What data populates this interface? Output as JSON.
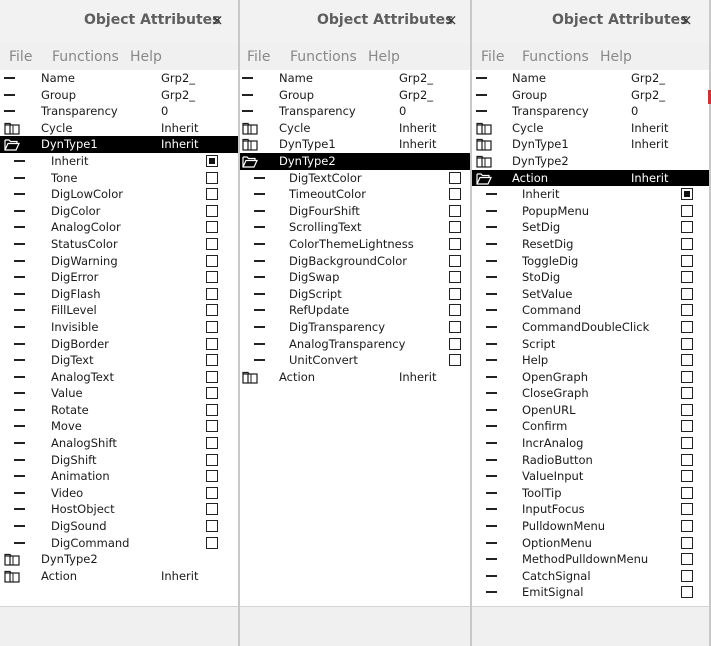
{
  "windows": [
    {
      "title": "Object Attributes",
      "close": "×",
      "menu": [
        "File",
        "Functions",
        "Help"
      ],
      "rows": [
        {
          "type": "attr",
          "name": "Name",
          "value": "Grp2_"
        },
        {
          "type": "attr",
          "name": "Group",
          "value": "Grp2_"
        },
        {
          "type": "attr",
          "name": "Transparency",
          "value": "0"
        },
        {
          "type": "folder",
          "name": "Cycle",
          "value": "Inherit"
        },
        {
          "type": "folder-open",
          "name": "DynType1",
          "value": "Inherit",
          "selected": true
        },
        {
          "type": "check",
          "name": "Inherit",
          "checked": true
        },
        {
          "type": "check",
          "name": "Tone"
        },
        {
          "type": "check",
          "name": "DigLowColor"
        },
        {
          "type": "check",
          "name": "DigColor"
        },
        {
          "type": "check",
          "name": "AnalogColor"
        },
        {
          "type": "check",
          "name": "StatusColor"
        },
        {
          "type": "check",
          "name": "DigWarning"
        },
        {
          "type": "check",
          "name": "DigError"
        },
        {
          "type": "check",
          "name": "DigFlash"
        },
        {
          "type": "check",
          "name": "FillLevel"
        },
        {
          "type": "check",
          "name": "Invisible"
        },
        {
          "type": "check",
          "name": "DigBorder"
        },
        {
          "type": "check",
          "name": "DigText"
        },
        {
          "type": "check",
          "name": "AnalogText"
        },
        {
          "type": "check",
          "name": "Value"
        },
        {
          "type": "check",
          "name": "Rotate"
        },
        {
          "type": "check",
          "name": "Move"
        },
        {
          "type": "check",
          "name": "AnalogShift"
        },
        {
          "type": "check",
          "name": "DigShift"
        },
        {
          "type": "check",
          "name": "Animation"
        },
        {
          "type": "check",
          "name": "Video"
        },
        {
          "type": "check",
          "name": "HostObject"
        },
        {
          "type": "check",
          "name": "DigSound"
        },
        {
          "type": "check",
          "name": "DigCommand"
        },
        {
          "type": "folder",
          "name": "DynType2",
          "value": ""
        },
        {
          "type": "folder",
          "name": "Action",
          "value": "Inherit"
        }
      ]
    },
    {
      "title": "Object Attributes",
      "close": "×",
      "menu": [
        "File",
        "Functions",
        "Help"
      ],
      "rows": [
        {
          "type": "attr",
          "name": "Name",
          "value": "Grp2_"
        },
        {
          "type": "attr",
          "name": "Group",
          "value": "Grp2_"
        },
        {
          "type": "attr",
          "name": "Transparency",
          "value": "0"
        },
        {
          "type": "folder",
          "name": "Cycle",
          "value": "Inherit"
        },
        {
          "type": "folder",
          "name": "DynType1",
          "value": "Inherit"
        },
        {
          "type": "folder-open",
          "name": "DynType2",
          "value": "",
          "selected": true
        },
        {
          "type": "check",
          "name": "DigTextColor"
        },
        {
          "type": "check",
          "name": "TimeoutColor"
        },
        {
          "type": "check",
          "name": "DigFourShift"
        },
        {
          "type": "check",
          "name": "ScrollingText"
        },
        {
          "type": "check",
          "name": "ColorThemeLightness"
        },
        {
          "type": "check",
          "name": "DigBackgroundColor"
        },
        {
          "type": "check",
          "name": "DigSwap"
        },
        {
          "type": "check",
          "name": "DigScript"
        },
        {
          "type": "check",
          "name": "RefUpdate"
        },
        {
          "type": "check",
          "name": "DigTransparency"
        },
        {
          "type": "check",
          "name": "AnalogTransparency"
        },
        {
          "type": "check",
          "name": "UnitConvert"
        },
        {
          "type": "folder",
          "name": "Action",
          "value": "Inherit"
        }
      ]
    },
    {
      "title": "Object Attributes",
      "close": "×",
      "menu": [
        "File",
        "Functions",
        "Help"
      ],
      "rows": [
        {
          "type": "attr",
          "name": "Name",
          "value": "Grp2_"
        },
        {
          "type": "attr",
          "name": "Group",
          "value": "Grp2_"
        },
        {
          "type": "attr",
          "name": "Transparency",
          "value": "0"
        },
        {
          "type": "folder",
          "name": "Cycle",
          "value": "Inherit"
        },
        {
          "type": "folder",
          "name": "DynType1",
          "value": "Inherit"
        },
        {
          "type": "folder",
          "name": "DynType2",
          "value": ""
        },
        {
          "type": "folder-open",
          "name": "Action",
          "value": "Inherit",
          "selected": true
        },
        {
          "type": "check",
          "name": "Inherit",
          "checked": true
        },
        {
          "type": "check",
          "name": "PopupMenu"
        },
        {
          "type": "check",
          "name": "SetDig"
        },
        {
          "type": "check",
          "name": "ResetDig"
        },
        {
          "type": "check",
          "name": "ToggleDig"
        },
        {
          "type": "check",
          "name": "StoDig"
        },
        {
          "type": "check",
          "name": "SetValue"
        },
        {
          "type": "check",
          "name": "Command"
        },
        {
          "type": "check",
          "name": "CommandDoubleClick"
        },
        {
          "type": "check",
          "name": "Script"
        },
        {
          "type": "check",
          "name": "Help"
        },
        {
          "type": "check",
          "name": "OpenGraph"
        },
        {
          "type": "check",
          "name": "CloseGraph"
        },
        {
          "type": "check",
          "name": "OpenURL"
        },
        {
          "type": "check",
          "name": "Confirm"
        },
        {
          "type": "check",
          "name": "IncrAnalog"
        },
        {
          "type": "check",
          "name": "RadioButton"
        },
        {
          "type": "check",
          "name": "ValueInput"
        },
        {
          "type": "check",
          "name": "ToolTip"
        },
        {
          "type": "check",
          "name": "InputFocus"
        },
        {
          "type": "check",
          "name": "PulldownMenu"
        },
        {
          "type": "check",
          "name": "OptionMenu"
        },
        {
          "type": "check",
          "name": "MethodPulldownMenu"
        },
        {
          "type": "check",
          "name": "CatchSignal"
        },
        {
          "type": "check",
          "name": "EmitSignal"
        }
      ]
    }
  ]
}
